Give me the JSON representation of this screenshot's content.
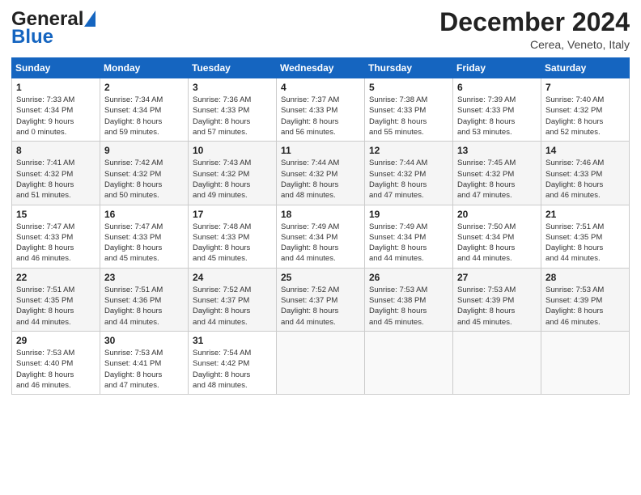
{
  "header": {
    "logo_general": "General",
    "logo_blue": "Blue",
    "month_title": "December 2024",
    "subtitle": "Cerea, Veneto, Italy"
  },
  "days_of_week": [
    "Sunday",
    "Monday",
    "Tuesday",
    "Wednesday",
    "Thursday",
    "Friday",
    "Saturday"
  ],
  "weeks": [
    [
      {
        "day": "1",
        "info": "Sunrise: 7:33 AM\nSunset: 4:34 PM\nDaylight: 9 hours\nand 0 minutes."
      },
      {
        "day": "2",
        "info": "Sunrise: 7:34 AM\nSunset: 4:34 PM\nDaylight: 8 hours\nand 59 minutes."
      },
      {
        "day": "3",
        "info": "Sunrise: 7:36 AM\nSunset: 4:33 PM\nDaylight: 8 hours\nand 57 minutes."
      },
      {
        "day": "4",
        "info": "Sunrise: 7:37 AM\nSunset: 4:33 PM\nDaylight: 8 hours\nand 56 minutes."
      },
      {
        "day": "5",
        "info": "Sunrise: 7:38 AM\nSunset: 4:33 PM\nDaylight: 8 hours\nand 55 minutes."
      },
      {
        "day": "6",
        "info": "Sunrise: 7:39 AM\nSunset: 4:33 PM\nDaylight: 8 hours\nand 53 minutes."
      },
      {
        "day": "7",
        "info": "Sunrise: 7:40 AM\nSunset: 4:32 PM\nDaylight: 8 hours\nand 52 minutes."
      }
    ],
    [
      {
        "day": "8",
        "info": "Sunrise: 7:41 AM\nSunset: 4:32 PM\nDaylight: 8 hours\nand 51 minutes."
      },
      {
        "day": "9",
        "info": "Sunrise: 7:42 AM\nSunset: 4:32 PM\nDaylight: 8 hours\nand 50 minutes."
      },
      {
        "day": "10",
        "info": "Sunrise: 7:43 AM\nSunset: 4:32 PM\nDaylight: 8 hours\nand 49 minutes."
      },
      {
        "day": "11",
        "info": "Sunrise: 7:44 AM\nSunset: 4:32 PM\nDaylight: 8 hours\nand 48 minutes."
      },
      {
        "day": "12",
        "info": "Sunrise: 7:44 AM\nSunset: 4:32 PM\nDaylight: 8 hours\nand 47 minutes."
      },
      {
        "day": "13",
        "info": "Sunrise: 7:45 AM\nSunset: 4:32 PM\nDaylight: 8 hours\nand 47 minutes."
      },
      {
        "day": "14",
        "info": "Sunrise: 7:46 AM\nSunset: 4:33 PM\nDaylight: 8 hours\nand 46 minutes."
      }
    ],
    [
      {
        "day": "15",
        "info": "Sunrise: 7:47 AM\nSunset: 4:33 PM\nDaylight: 8 hours\nand 46 minutes."
      },
      {
        "day": "16",
        "info": "Sunrise: 7:47 AM\nSunset: 4:33 PM\nDaylight: 8 hours\nand 45 minutes."
      },
      {
        "day": "17",
        "info": "Sunrise: 7:48 AM\nSunset: 4:33 PM\nDaylight: 8 hours\nand 45 minutes."
      },
      {
        "day": "18",
        "info": "Sunrise: 7:49 AM\nSunset: 4:34 PM\nDaylight: 8 hours\nand 44 minutes."
      },
      {
        "day": "19",
        "info": "Sunrise: 7:49 AM\nSunset: 4:34 PM\nDaylight: 8 hours\nand 44 minutes."
      },
      {
        "day": "20",
        "info": "Sunrise: 7:50 AM\nSunset: 4:34 PM\nDaylight: 8 hours\nand 44 minutes."
      },
      {
        "day": "21",
        "info": "Sunrise: 7:51 AM\nSunset: 4:35 PM\nDaylight: 8 hours\nand 44 minutes."
      }
    ],
    [
      {
        "day": "22",
        "info": "Sunrise: 7:51 AM\nSunset: 4:35 PM\nDaylight: 8 hours\nand 44 minutes."
      },
      {
        "day": "23",
        "info": "Sunrise: 7:51 AM\nSunset: 4:36 PM\nDaylight: 8 hours\nand 44 minutes."
      },
      {
        "day": "24",
        "info": "Sunrise: 7:52 AM\nSunset: 4:37 PM\nDaylight: 8 hours\nand 44 minutes."
      },
      {
        "day": "25",
        "info": "Sunrise: 7:52 AM\nSunset: 4:37 PM\nDaylight: 8 hours\nand 44 minutes."
      },
      {
        "day": "26",
        "info": "Sunrise: 7:53 AM\nSunset: 4:38 PM\nDaylight: 8 hours\nand 45 minutes."
      },
      {
        "day": "27",
        "info": "Sunrise: 7:53 AM\nSunset: 4:39 PM\nDaylight: 8 hours\nand 45 minutes."
      },
      {
        "day": "28",
        "info": "Sunrise: 7:53 AM\nSunset: 4:39 PM\nDaylight: 8 hours\nand 46 minutes."
      }
    ],
    [
      {
        "day": "29",
        "info": "Sunrise: 7:53 AM\nSunset: 4:40 PM\nDaylight: 8 hours\nand 46 minutes."
      },
      {
        "day": "30",
        "info": "Sunrise: 7:53 AM\nSunset: 4:41 PM\nDaylight: 8 hours\nand 47 minutes."
      },
      {
        "day": "31",
        "info": "Sunrise: 7:54 AM\nSunset: 4:42 PM\nDaylight: 8 hours\nand 48 minutes."
      },
      {
        "day": "",
        "info": ""
      },
      {
        "day": "",
        "info": ""
      },
      {
        "day": "",
        "info": ""
      },
      {
        "day": "",
        "info": ""
      }
    ]
  ]
}
